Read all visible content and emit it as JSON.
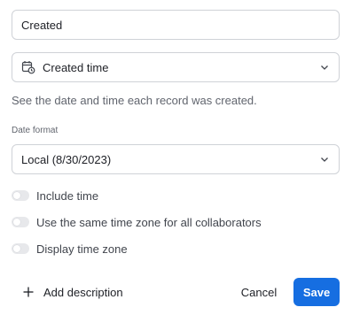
{
  "field_name": {
    "value": "Created"
  },
  "field_type": {
    "label": "Created time",
    "icon": "calendar-clock-icon"
  },
  "description": "See the date and time each record was created.",
  "date_format": {
    "section_label": "Date format",
    "selected": "Local (8/30/2023)"
  },
  "options": [
    {
      "label": "Include time",
      "on": false
    },
    {
      "label": "Use the same time zone for all collaborators",
      "on": false
    },
    {
      "label": "Display time zone",
      "on": false
    }
  ],
  "footer": {
    "add_description": "Add description",
    "cancel": "Cancel",
    "save": "Save"
  },
  "colors": {
    "primary": "#166ee1",
    "border": "#cfd2d7",
    "muted_text": "#61656e",
    "toggle_off": "#e7e8eb"
  }
}
